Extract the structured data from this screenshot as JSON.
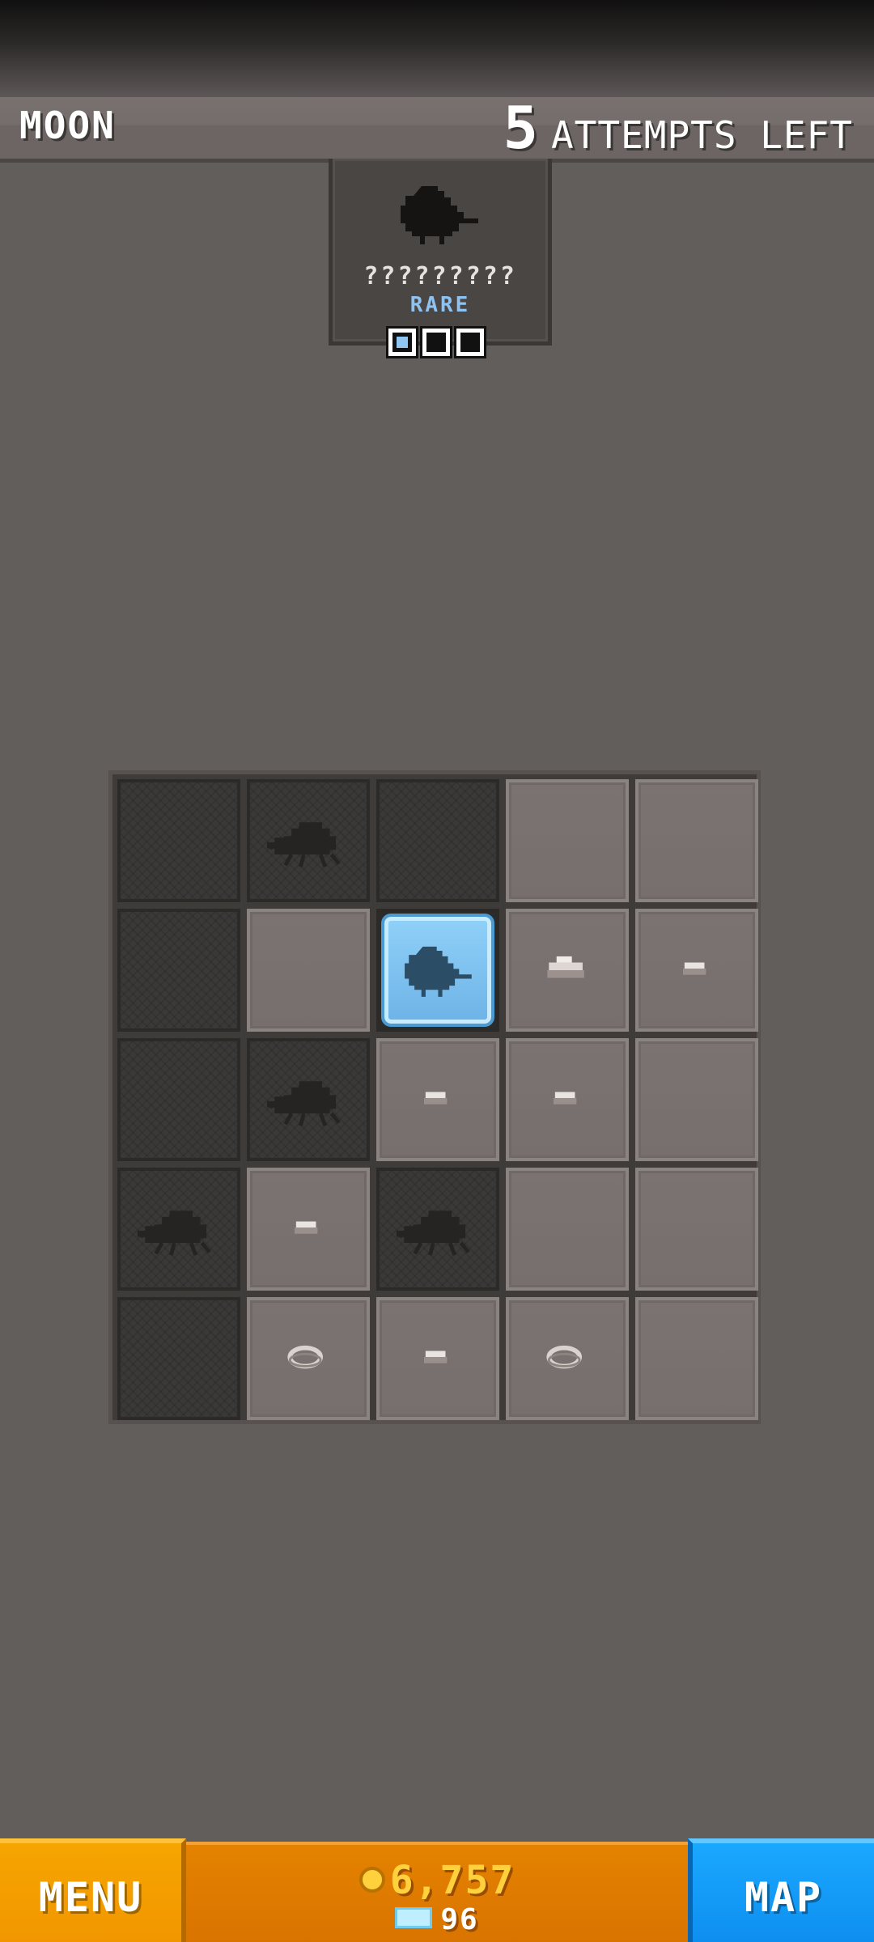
{
  "header": {
    "level_name": "MOON",
    "attempts_count": "5",
    "attempts_label": "ATTEMPTS LEFT"
  },
  "target": {
    "name": "?????????",
    "rarity": "RARE",
    "progress_found": 1,
    "progress_total": 3,
    "icon": "bird-silhouette-icon"
  },
  "grid": {
    "rows": 5,
    "cols": 5,
    "cells": [
      [
        "dug",
        "dug-beetle",
        "dug",
        "undug",
        "undug"
      ],
      [
        "dug",
        "undug",
        "found-bird",
        "undug-rock-large",
        "undug-pebble"
      ],
      [
        "dug",
        "dug-beetle",
        "undug-pebble",
        "undug-pebble",
        "undug"
      ],
      [
        "dug-beetle",
        "undug-pebble",
        "dug-beetle",
        "undug",
        "undug"
      ],
      [
        "dug",
        "undug-ring",
        "undug-pebble",
        "undug-ring",
        "undug"
      ]
    ]
  },
  "footer": {
    "menu_label": "MENU",
    "coins": "6,757",
    "gems": "96",
    "map_label": "MAP"
  },
  "colors": {
    "background": "#625e5b",
    "menu_orange": "#f6a500",
    "panel_orange": "#e48200",
    "map_blue": "#1aa8ff",
    "coin_yellow": "#ffd23d",
    "found_blue": "#8fd0f8"
  }
}
